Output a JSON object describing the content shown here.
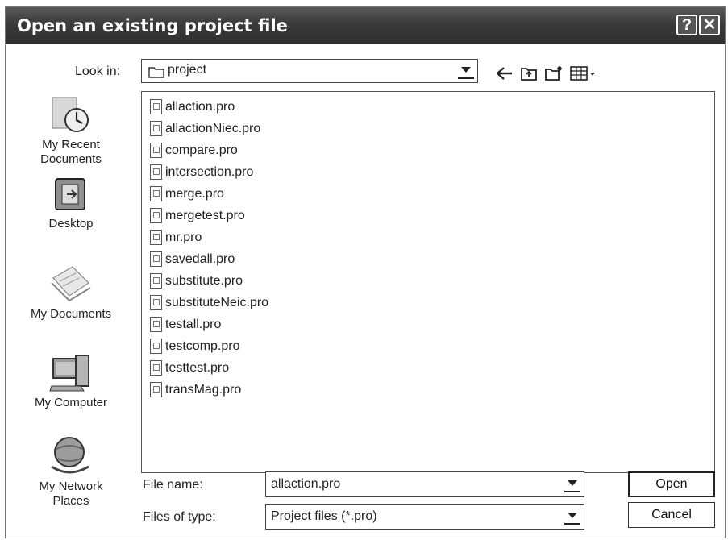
{
  "window": {
    "title": "Open an existing project file"
  },
  "titlebar": {
    "help_label": "?",
    "close_label": "✕"
  },
  "look_in": {
    "label": "Look in:",
    "value": "project"
  },
  "toolbar": {
    "back_icon": "arrow-left-icon",
    "up_icon": "up-folder-icon",
    "new_folder_icon": "new-folder-icon",
    "views_icon": "views-menu-icon"
  },
  "places": [
    {
      "label_line1": "My Recent",
      "label_line2": "Documents",
      "icon": "recent-documents-icon"
    },
    {
      "label_line1": "Desktop",
      "label_line2": "",
      "icon": "desktop-icon"
    },
    {
      "label_line1": "My Documents",
      "label_line2": "",
      "icon": "my-documents-icon"
    },
    {
      "label_line1": "My Computer",
      "label_line2": "",
      "icon": "my-computer-icon"
    },
    {
      "label_line1": "My Network",
      "label_line2": "Places",
      "icon": "network-places-icon"
    }
  ],
  "files": [
    "allaction.pro",
    "allactionNiec.pro",
    "compare.pro",
    "intersection.pro",
    "merge.pro",
    "mergetest.pro",
    "mr.pro",
    "savedall.pro",
    "substitute.pro",
    "substituteNeic.pro",
    "testall.pro",
    "testcomp.pro",
    "testtest.pro",
    "transMag.pro"
  ],
  "file_name": {
    "label": "File name:",
    "value": "allaction.pro"
  },
  "file_type": {
    "label": "Files of type:",
    "value": "Project files (*.pro)"
  },
  "buttons": {
    "open": "Open",
    "cancel": "Cancel"
  }
}
